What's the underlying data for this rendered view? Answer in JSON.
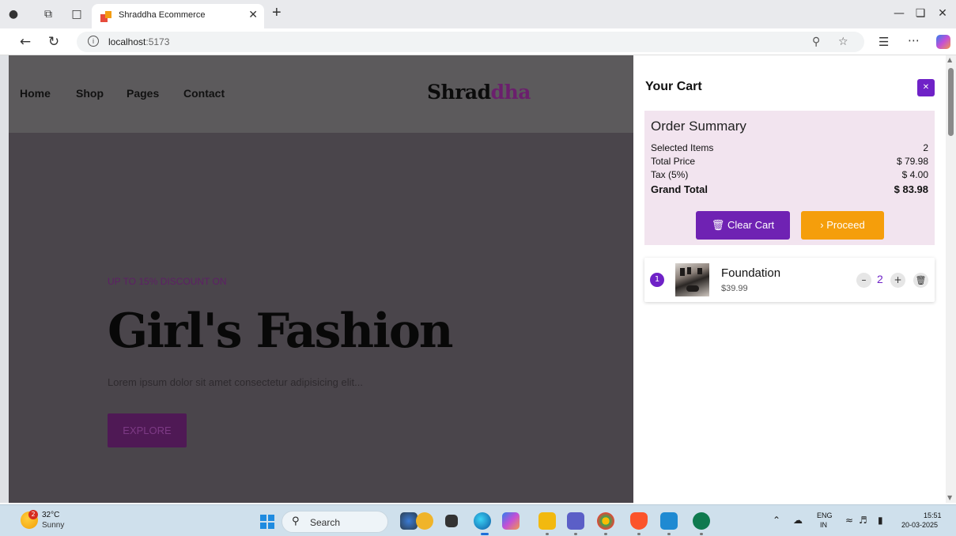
{
  "browser": {
    "tab_title": "Shraddha Ecommerce",
    "url_host": "localhost",
    "url_port": ":5173"
  },
  "site": {
    "nav": [
      "Home",
      "Shop",
      "Pages",
      "Contact"
    ],
    "logo_main": "Shrad",
    "logo_accent": "dha",
    "hero": {
      "kicker": "UP TO 15% DISCOUNT ON",
      "title": "Girl's Fashion",
      "text": "Lorem ipsum dolor sit amet consectetur adipisicing elit...",
      "cta": "EXPLORE"
    }
  },
  "cart": {
    "title": "Your Cart",
    "close": "✕",
    "summary": {
      "title": "Order Summary",
      "rows": [
        {
          "label": "Selected Items",
          "value": "2"
        },
        {
          "label": "Total Price",
          "value": "$ 79.98"
        },
        {
          "label": "Tax (5%)",
          "value": "$ 4.00"
        }
      ],
      "grand_label": "Grand Total",
      "grand_value": "$ 83.98",
      "clear_label": "Clear Cart",
      "proceed_label": "Proceed"
    },
    "items": [
      {
        "index": "1",
        "name": "Foundation",
        "price": "$39.99",
        "qty": "2"
      }
    ]
  },
  "taskbar": {
    "temp": "32°C",
    "condition": "Sunny",
    "weather_badge": "2",
    "search_label": "Search",
    "lang_top": "ENG",
    "lang_bottom": "IN",
    "time": "15:51",
    "date": "20-03-2025"
  },
  "colors": {
    "accent_purple": "#6f22c7",
    "proceed_orange": "#f59e0b",
    "summary_bg": "#f2e4ef"
  }
}
